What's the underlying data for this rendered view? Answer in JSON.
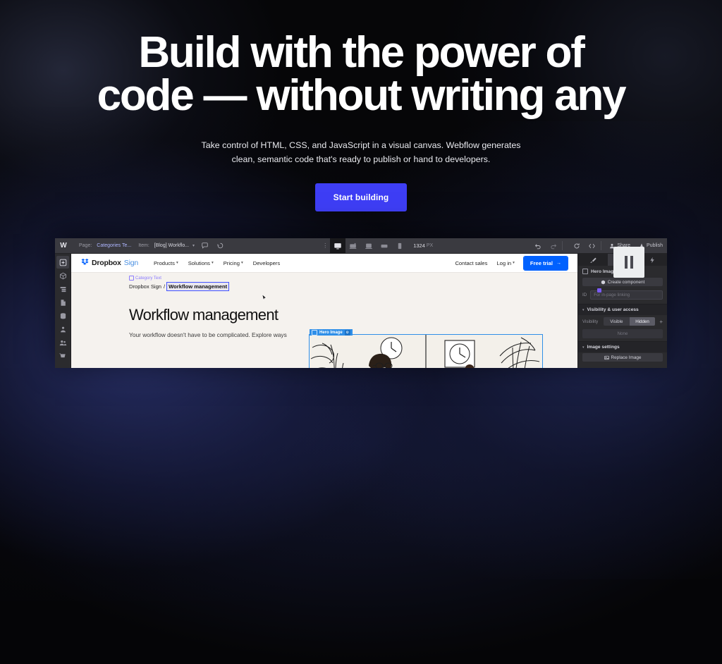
{
  "hero": {
    "heading_line1": "Build with the power of",
    "heading_line2": "code — without writing any",
    "sub_line1": "Take control of HTML, CSS, and JavaScript in a visual canvas. Webflow generates",
    "sub_line2": "clean, semantic code that's ready to publish or hand to developers.",
    "cta_label": "Start building",
    "cta_color": "#3e3ef5"
  },
  "designer": {
    "logo": "W",
    "topbar": {
      "page_label": "Page:",
      "page_value": "Categories Te...",
      "item_label": "Item:",
      "item_value": "[Blog] Workflo...",
      "canvas_width": "1324",
      "canvas_unit": "PX",
      "share_label": "Share",
      "publish_label": "Publish",
      "breakpoints": [
        "desktop",
        "tablet-large",
        "tablet",
        "mobile-landscape",
        "mobile-portrait"
      ],
      "active_breakpoint": "desktop"
    },
    "left_sidebar": [
      {
        "name": "add-elements",
        "icon": "plus-box-icon"
      },
      {
        "name": "components",
        "icon": "cube-icon"
      },
      {
        "name": "navigator",
        "icon": "layers-icon"
      },
      {
        "name": "pages",
        "icon": "page-icon"
      },
      {
        "name": "cms",
        "icon": "database-icon"
      },
      {
        "name": "assets",
        "icon": "assets-icon"
      },
      {
        "name": "users",
        "icon": "users-icon"
      },
      {
        "name": "ecommerce",
        "icon": "cart-icon"
      }
    ],
    "right_panel": {
      "tabs": [
        "style-paint-tab",
        "settings-gear-tab",
        "interactions-tab"
      ],
      "active_tab": "settings-gear-tab",
      "section_title": "Hero Image Settings",
      "create_component_label": "Create component",
      "id_label": "ID",
      "id_placeholder": "For in-page linking",
      "visibility_section_title": "Visibility & user access",
      "visibility_label": "Visibility",
      "visibility_options": [
        "Visible",
        "Hidden"
      ],
      "visibility_selected": "Hidden",
      "access_value": "None",
      "image_section_title": "Image settings",
      "replace_image_label": "Replace Image"
    },
    "canvas": {
      "site_nav": {
        "brand_primary": "Dropbox",
        "brand_secondary": "Sign",
        "links": [
          "Products",
          "Solutions",
          "Pricing",
          "Developers"
        ],
        "links_with_caret": [
          "Products",
          "Solutions",
          "Pricing"
        ],
        "contact_label": "Contact sales",
        "login_label": "Log in",
        "trial_label": "Free trial",
        "trial_color": "#0061fe"
      },
      "breadcrumb_root": "Dropbox Sign",
      "breadcrumb_sep": "/",
      "breadcrumb_current": "Workflow management",
      "selection_badge": "Category Text",
      "page_title": "Workflow management",
      "page_body": "Your workflow doesn't have to be complicated. Explore ways",
      "hero_image_badge": "Hero Image"
    }
  },
  "overlay": {
    "pause_button": "pause-icon"
  }
}
